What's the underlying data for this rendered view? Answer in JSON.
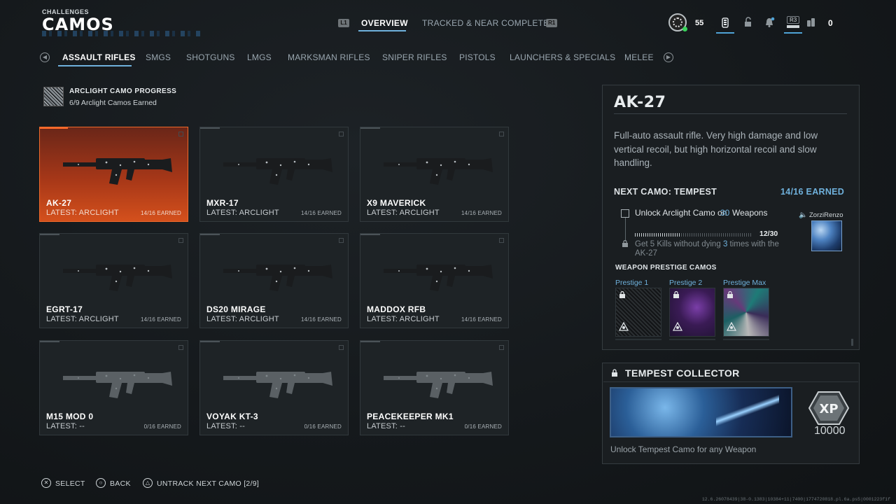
{
  "header": {
    "kicker": "CHALLENGES",
    "title": "CAMOS",
    "tabs": {
      "l1": "L1",
      "overview": "OVERVIEW",
      "tracked": "TRACKED & NEAR COMPLETE",
      "r1": "R1"
    },
    "player_level": "55",
    "r3": "R3",
    "currency": "0",
    "icons": [
      "prestige-emblem",
      "battery-icon",
      "lock-icon",
      "bell-icon",
      "controller-icon",
      "currency-icon"
    ]
  },
  "categories": {
    "items": [
      "ASSAULT RIFLES",
      "SMGS",
      "SHOTGUNS",
      "LMGS",
      "MARKSMAN RIFLES",
      "SNIPER RIFLES",
      "PISTOLS",
      "LAUNCHERS & SPECIALS",
      "MELEE"
    ],
    "active": "ASSAULT RIFLES"
  },
  "progress": {
    "title": "ARCLIGHT CAMO PROGRESS",
    "subtitle": "6/9 Arclight Camos Earned"
  },
  "weapons": [
    {
      "name": "AK-27",
      "latest": "LATEST: ARCLIGHT",
      "earned": "14/16 EARNED",
      "selected": true
    },
    {
      "name": "MXR-17",
      "latest": "LATEST: ARCLIGHT",
      "earned": "14/16 EARNED"
    },
    {
      "name": "X9 MAVERICK",
      "latest": "LATEST: ARCLIGHT",
      "earned": "14/16 EARNED"
    },
    {
      "name": "EGRT-17",
      "latest": "LATEST: ARCLIGHT",
      "earned": "14/16 EARNED"
    },
    {
      "name": "DS20 MIRAGE",
      "latest": "LATEST: ARCLIGHT",
      "earned": "14/16 EARNED"
    },
    {
      "name": "MADDOX RFB",
      "latest": "LATEST: ARCLIGHT",
      "earned": "14/16 EARNED"
    },
    {
      "name": "M15 MOD 0",
      "latest": "LATEST: --",
      "earned": "0/16 EARNED"
    },
    {
      "name": "VOYAK KT-3",
      "latest": "LATEST: --",
      "earned": "0/16 EARNED"
    },
    {
      "name": "PEACEKEEPER MK1",
      "latest": "LATEST: --",
      "earned": "0/16 EARNED"
    }
  ],
  "detail": {
    "name": "AK-27",
    "description": "Full-auto assault rifle. Very high damage and low vertical recoil, but high horizontal recoil and slow handling.",
    "next_camo": "NEXT CAMO: TEMPEST",
    "next_earned": "14/16 EARNED",
    "challenge1": {
      "pre": "Unlock Arclight Camo on",
      "num": "30",
      "post": "Weapons",
      "count": "12/30",
      "progress": 0.4
    },
    "challenge2": {
      "pre": "Get 5 Kills without dying",
      "num": "3",
      "post": "times with the AK-27"
    },
    "credit": "ZorziRenzo",
    "prestige_title": "WEAPON PRESTIGE CAMOS",
    "prestige": [
      "Prestige 1",
      "Prestige 2",
      "Prestige Max"
    ]
  },
  "reward": {
    "title": "TEMPEST COLLECTOR",
    "xp_label": "XP",
    "xp_value": "10000",
    "description": "Unlock Tempest Camo for any Weapon"
  },
  "footer": {
    "select": "SELECT",
    "back": "BACK",
    "untrack": "UNTRACK NEXT CAMO [2/9]",
    "build": "12.6.26078439|38-0.1383|10384+11|7400|1774720818.pl.6a.ps5|0001223f1f"
  },
  "colors": {
    "accent": "#6fb1dc",
    "selected": "#d4501c",
    "online": "#38d35a"
  }
}
